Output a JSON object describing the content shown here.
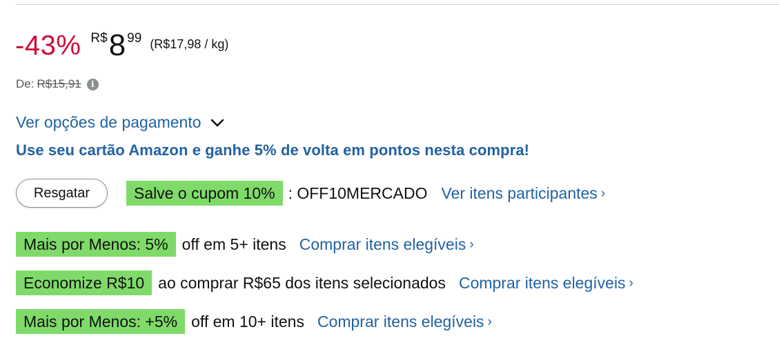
{
  "price": {
    "discount": "-43%",
    "currency_symbol": "R$",
    "whole": "8",
    "fraction": "99",
    "unit_price": "(R$17,98 / kg)",
    "list_label": "De:",
    "list_price": "R$15,91"
  },
  "payment": {
    "options_link": "Ver opções de pagamento",
    "card_promo": "Use seu cartão Amazon e ganhe 5% de volta em pontos nesta compra!"
  },
  "coupon": {
    "redeem_button": "Resgatar",
    "badge": "Salve o cupom 10%",
    "code": ": OFF10MERCADO",
    "link": "Ver itens participantes"
  },
  "promotions": [
    {
      "badge": "Mais por Menos: 5%",
      "description": "off em 5+ itens",
      "link": "Comprar itens elegíveis"
    },
    {
      "badge": "Economize R$10",
      "description": "ao comprar R$65 dos itens selecionados",
      "link": "Comprar itens elegíveis"
    },
    {
      "badge": "Mais por Menos: +5%",
      "description": "off em 10+ itens",
      "link": "Comprar itens elegíveis"
    }
  ],
  "icons": {
    "info": "info-icon",
    "chevron": "chevron-down-icon",
    "arrow": "chevron-right-icon"
  },
  "colors": {
    "discount": "#cc0c39",
    "link": "#2162a1",
    "badge": "#7fda69",
    "text": "#0f1111",
    "muted": "#565959"
  }
}
